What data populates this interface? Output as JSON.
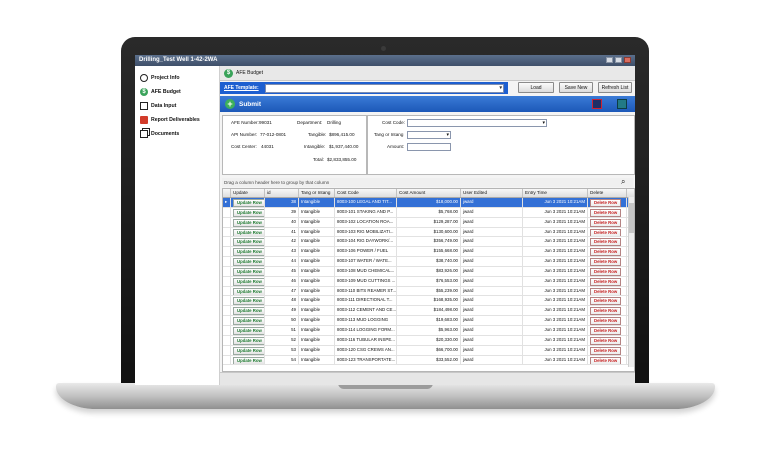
{
  "window": {
    "title": "Drilling_Test Well 1-42-2WA"
  },
  "sidebar": {
    "items": [
      {
        "label": "Project Info",
        "icon": "info-icon"
      },
      {
        "label": "AFE Budget",
        "icon": "dollar-icon"
      },
      {
        "label": "Data Input",
        "icon": "pencil-icon"
      },
      {
        "label": "Report Deliverables",
        "icon": "report-icon"
      },
      {
        "label": "Documents",
        "icon": "documents-icon"
      }
    ]
  },
  "tab": {
    "label": "AFE Budget"
  },
  "template": {
    "label": "AFE Template:",
    "value": ""
  },
  "buttons": {
    "load": "Load",
    "save_new": "Save New",
    "refresh": "Refresh List"
  },
  "submit": {
    "label": "Submit"
  },
  "afe": {
    "afe_number_label": "AFE Number:",
    "afe_number": "99031",
    "api_number_label": "API Number:",
    "api_number": "77-012-0801",
    "cost_center_label": "Cost Center:",
    "cost_center": "44031",
    "department_label": "Department:",
    "department": "Drilling",
    "tangible_label": "Tangible:",
    "tangible": "$896,415.00",
    "intangible_label": "Intangible:",
    "intangible": "$1,937,440.00",
    "total_label": "Total:",
    "total": "$2,833,855.00"
  },
  "form": {
    "cost_code_label": "Cost Code:",
    "tang_label": "Tang or Intang",
    "amount_label": "Amount:"
  },
  "grid": {
    "hint": "Drag a column header here to group by that column",
    "columns": [
      "Update",
      "id",
      "Tang or Intang",
      "Cost Code",
      "Cost Amount",
      "User Edited",
      "Entry Time",
      "Delete"
    ],
    "update_label": "Update Row",
    "delete_label": "Delete Row",
    "rows": [
      {
        "id": "38",
        "tang": "Intangible",
        "code": "8003-100 LEGAL AND TIT...",
        "amount": "$18,000.00",
        "user": "jward",
        "time": "Jun 3 2021 10:21AM",
        "selected": true
      },
      {
        "id": "39",
        "tang": "Intangible",
        "code": "8003-101 STAKING AND P...",
        "amount": "$5,768.00",
        "user": "jward",
        "time": "Jun 3 2021 10:21AM"
      },
      {
        "id": "40",
        "tang": "Intangible",
        "code": "8003-102 LOCATION ROA...",
        "amount": "$129,287.00",
        "user": "jward",
        "time": "Jun 3 2021 10:21AM"
      },
      {
        "id": "41",
        "tang": "Intangible",
        "code": "8003-103 RIG MOBILIZATI...",
        "amount": "$130,600.00",
        "user": "jward",
        "time": "Jun 3 2021 10:21AM"
      },
      {
        "id": "42",
        "tang": "Intangible",
        "code": "8003-104 RIG DAYWORK/...",
        "amount": "$356,749.00",
        "user": "jward",
        "time": "Jun 3 2021 10:21AM"
      },
      {
        "id": "43",
        "tang": "Intangible",
        "code": "8003-106 POWER / FUEL",
        "amount": "$155,668.00",
        "user": "jward",
        "time": "Jun 3 2021 10:21AM"
      },
      {
        "id": "44",
        "tang": "Intangible",
        "code": "8003-107 WATER / WATE...",
        "amount": "$38,740.00",
        "user": "jward",
        "time": "Jun 3 2021 10:21AM"
      },
      {
        "id": "45",
        "tang": "Intangible",
        "code": "8003-108 MUD CHEMICAL...",
        "amount": "$83,926.00",
        "user": "jward",
        "time": "Jun 3 2021 10:21AM"
      },
      {
        "id": "46",
        "tang": "Intangible",
        "code": "8003-109 MUD CUTTINGS ...",
        "amount": "$76,553.00",
        "user": "jward",
        "time": "Jun 3 2021 10:21AM"
      },
      {
        "id": "47",
        "tang": "Intangible",
        "code": "8003-110 BITS REAMER ST...",
        "amount": "$55,239.00",
        "user": "jward",
        "time": "Jun 3 2021 10:21AM"
      },
      {
        "id": "48",
        "tang": "Intangible",
        "code": "8003-111 DIRECTIONAL T...",
        "amount": "$168,935.00",
        "user": "jward",
        "time": "Jun 3 2021 10:21AM"
      },
      {
        "id": "49",
        "tang": "Intangible",
        "code": "8003-112 CEMENT AND CE...",
        "amount": "$184,498.00",
        "user": "jward",
        "time": "Jun 3 2021 10:21AM"
      },
      {
        "id": "50",
        "tang": "Intangible",
        "code": "8003-113 MUD LOGGING",
        "amount": "$19,683.00",
        "user": "jward",
        "time": "Jun 3 2021 10:21AM"
      },
      {
        "id": "51",
        "tang": "Intangible",
        "code": "8003-114 LOGGING FORM...",
        "amount": "$5,963.00",
        "user": "jward",
        "time": "Jun 3 2021 10:21AM"
      },
      {
        "id": "52",
        "tang": "Intangible",
        "code": "8003-116 TUBULAR INSPE...",
        "amount": "$20,330.00",
        "user": "jward",
        "time": "Jun 3 2021 10:21AM"
      },
      {
        "id": "53",
        "tang": "Intangible",
        "code": "8003-120 CSG CREWS AN...",
        "amount": "$66,700.00",
        "user": "jward",
        "time": "Jun 3 2021 10:21AM"
      },
      {
        "id": "54",
        "tang": "Intangible",
        "code": "8003-123 TRANSPORTATE...",
        "amount": "$33,552.00",
        "user": "jward",
        "time": "Jun 3 2021 10:21AM"
      }
    ]
  },
  "colors": {
    "accent": "#1d5fd0",
    "submit_green": "#3db05b",
    "update_text": "#1d7a2f",
    "delete_text": "#c41d1d"
  }
}
